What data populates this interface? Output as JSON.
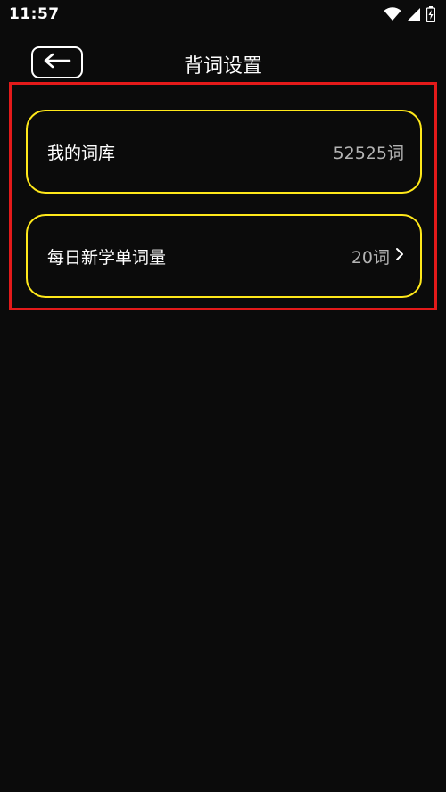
{
  "status_bar": {
    "time": "11:57",
    "icons": [
      "wifi-icon",
      "cell-signal-icon",
      "battery-icon"
    ]
  },
  "header": {
    "back_icon": "arrow-left-icon",
    "title": "背词设置"
  },
  "settings": [
    {
      "label": "我的词库",
      "value": "52525词",
      "has_chevron": false
    },
    {
      "label": "每日新学单词量",
      "value": "20词",
      "has_chevron": true
    }
  ],
  "colors": {
    "background": "#0b0b0b",
    "card_border": "#ffe81a",
    "highlight_border": "#e31a1a",
    "value_text": "#b4b4b4"
  }
}
